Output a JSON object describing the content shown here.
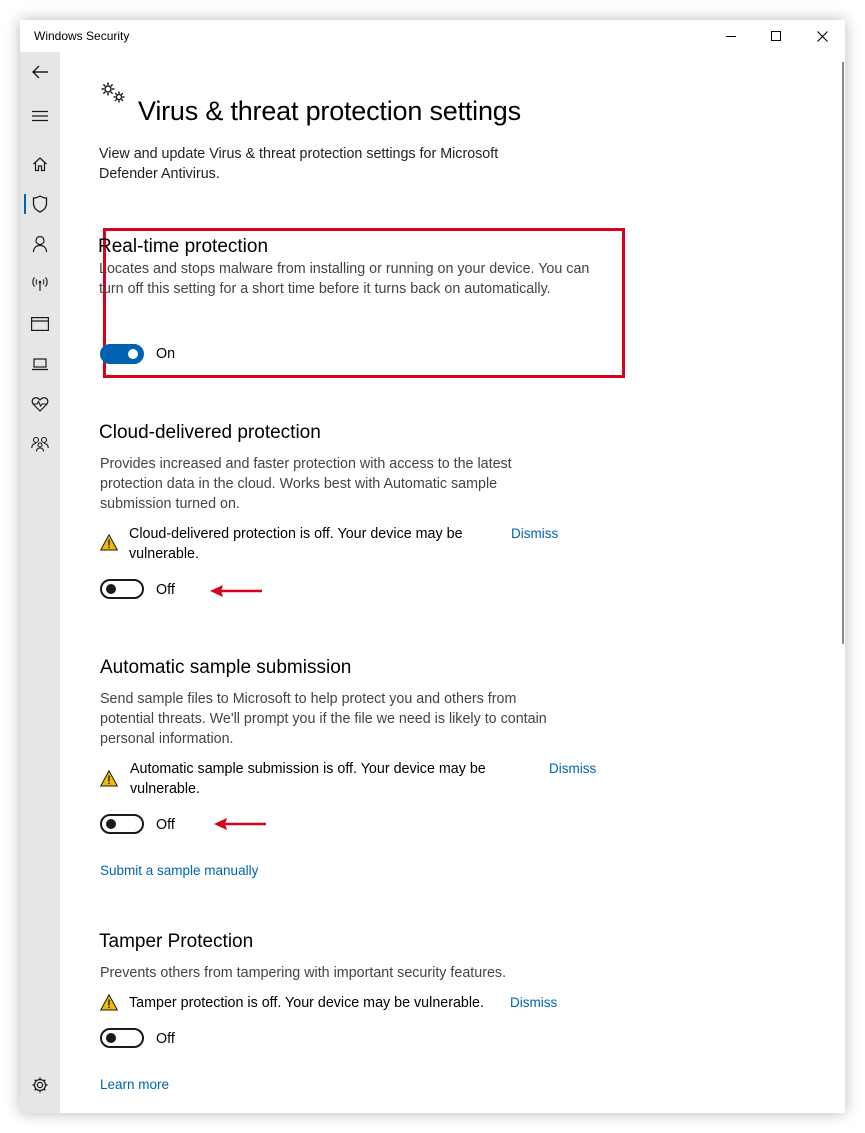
{
  "window": {
    "title": "Windows Security",
    "controls": {
      "minimize": "minimize-icon",
      "maximize": "maximize-icon",
      "close": "close-icon"
    }
  },
  "sidebar": {
    "items": [
      {
        "name": "back",
        "icon": "back-arrow-icon"
      },
      {
        "name": "menu",
        "icon": "hamburger-icon"
      },
      {
        "name": "home",
        "icon": "home-icon"
      },
      {
        "name": "virus-protection",
        "icon": "shield-icon",
        "active": true
      },
      {
        "name": "account-protection",
        "icon": "person-icon"
      },
      {
        "name": "firewall",
        "icon": "antenna-icon"
      },
      {
        "name": "app-browser-control",
        "icon": "browser-window-icon"
      },
      {
        "name": "device-security",
        "icon": "laptop-icon"
      },
      {
        "name": "device-performance",
        "icon": "heart-pulse-icon"
      },
      {
        "name": "family-options",
        "icon": "family-icon"
      },
      {
        "name": "settings",
        "icon": "gear-icon"
      }
    ]
  },
  "page": {
    "title": "Virus & threat protection settings",
    "icon": "gears-icon",
    "description": "View and update Virus & threat protection settings for Microsoft Defender Antivirus."
  },
  "sections": {
    "realtime": {
      "title": "Real-time protection",
      "description": "Locates and stops malware from installing or running on your device. You can turn off this setting for a short time before it turns back on automatically.",
      "toggle_state": "On"
    },
    "cloud": {
      "title": "Cloud-delivered protection",
      "description": "Provides increased and faster protection with access to the latest protection data in the cloud. Works best with Automatic sample submission turned on.",
      "warning": "Cloud-delivered protection is off. Your device may be vulnerable.",
      "dismiss": "Dismiss",
      "toggle_state": "Off"
    },
    "sample": {
      "title": "Automatic sample submission",
      "description": "Send sample files to Microsoft to help protect you and others from potential threats. We'll prompt you if the file we need is likely to contain personal information.",
      "warning": "Automatic sample submission is off. Your device may be vulnerable.",
      "dismiss": "Dismiss",
      "toggle_state": "Off",
      "link": "Submit a sample manually"
    },
    "tamper": {
      "title": "Tamper Protection",
      "description": "Prevents others from tampering with important security features.",
      "warning": "Tamper protection is off. Your device may be vulnerable.",
      "dismiss": "Dismiss",
      "toggle_state": "Off",
      "link": "Learn more"
    }
  },
  "colors": {
    "accent": "#0063b1",
    "highlight": "#d8001e",
    "warning": "#f2b900",
    "sidebar_bg": "#e6e6e6"
  }
}
